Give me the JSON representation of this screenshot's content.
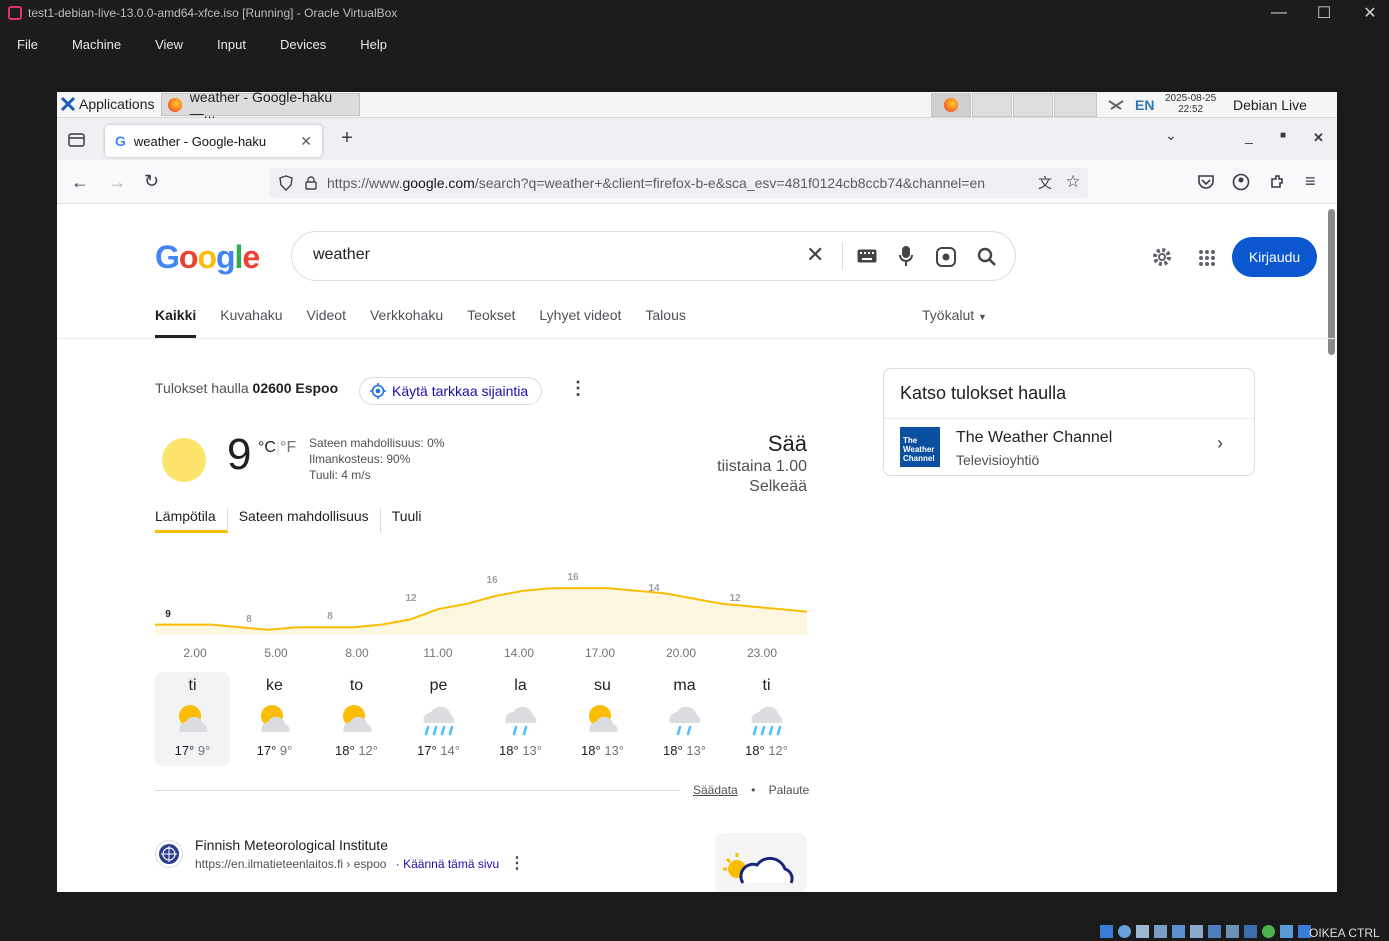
{
  "vbox": {
    "title": "test1-debian-live-13.0.0-amd64-xfce.iso [Running] - Oracle VirtualBox",
    "menu": [
      "File",
      "Machine",
      "View",
      "Input",
      "Devices",
      "Help"
    ],
    "host_key": "OIKEA CTRL"
  },
  "xfce": {
    "applications": "Applications",
    "task_title": "weather - Google-haku —...",
    "lang": "EN",
    "date": "2025-08-25",
    "time": "22:52",
    "user": "Debian Live user"
  },
  "browser": {
    "tab_title": "weather - Google-haku",
    "url_prefix": "https://www.",
    "url_domain": "google.com",
    "url_rest": "/search?q=weather+&client=firefox-b-e&sca_esv=481f0124cb8ccb74&channel=en"
  },
  "google": {
    "query": "weather",
    "signin": "Kirjaudu",
    "tabs": [
      "Kaikki",
      "Kuvahaku",
      "Videot",
      "Verkkohaku",
      "Teokset",
      "Lyhyet videot",
      "Talous"
    ],
    "tools": "Työkalut"
  },
  "weather": {
    "results_prefix": "Tulokset haulla",
    "location": "02600 Espoo",
    "precise_location": "Käytä tarkkaa sijaintia",
    "temp": "9",
    "unit_c": "°C",
    "unit_sep": "|",
    "unit_f": "°F",
    "precip": "Sateen mahdollisuus: 0%",
    "humidity": "Ilmankosteus: 90%",
    "wind": "Tuuli: 4 m/s",
    "heading": "Sää",
    "day": "tiistaina 1.00",
    "condition": "Selkeää",
    "tabs": [
      "Lämpötila",
      "Sateen mahdollisuus",
      "Tuuli"
    ],
    "hours": [
      "2.00",
      "5.00",
      "8.00",
      "11.00",
      "14.00",
      "17.00",
      "20.00",
      "23.00"
    ],
    "chart_labels": [
      "9",
      "8",
      "8",
      "12",
      "16",
      "16",
      "14",
      "12"
    ],
    "days": [
      {
        "name": "ti",
        "hi": "17°",
        "lo": "9°",
        "icon": "partly-cloudy"
      },
      {
        "name": "ke",
        "hi": "17°",
        "lo": "9°",
        "icon": "partly-cloudy"
      },
      {
        "name": "to",
        "hi": "18°",
        "lo": "12°",
        "icon": "partly-cloudy"
      },
      {
        "name": "pe",
        "hi": "17°",
        "lo": "14°",
        "icon": "rain"
      },
      {
        "name": "la",
        "hi": "18°",
        "lo": "13°",
        "icon": "light-rain"
      },
      {
        "name": "su",
        "hi": "18°",
        "lo": "13°",
        "icon": "partly-cloudy"
      },
      {
        "name": "ma",
        "hi": "18°",
        "lo": "13°",
        "icon": "light-rain"
      },
      {
        "name": "ti",
        "hi": "18°",
        "lo": "12°",
        "icon": "rain"
      }
    ],
    "data_source": "Säädata",
    "bullet": "•",
    "feedback": "Palaute"
  },
  "knowledge": {
    "title": "Katso tulokset haulla",
    "item_name": "The Weather Channel",
    "item_sub": "Televisioyhtiö",
    "logo_text": "The Weather Channel"
  },
  "result": {
    "site_name": "Finnish Meteorological Institute",
    "cite": "https://en.ilmatieteenlaitos.fi › espoo",
    "translate": "Käännä tämä sivu"
  },
  "chart_data": {
    "type": "area",
    "x": [
      "1.00",
      "2.00",
      "3.00",
      "4.00",
      "5.00",
      "6.00",
      "7.00",
      "8.00",
      "9.00",
      "10.00",
      "11.00",
      "12.00",
      "13.00",
      "14.00",
      "15.00",
      "16.00",
      "17.00",
      "18.00",
      "19.00",
      "20.00",
      "21.00",
      "22.00",
      "23.00",
      "24.00"
    ],
    "values": [
      9,
      9,
      9,
      8.5,
      8,
      8.5,
      8.5,
      8.5,
      9,
      10,
      12,
      13,
      14.5,
      15.5,
      16,
      16,
      16,
      15.5,
      15,
      14,
      13,
      12.5,
      12,
      11.5
    ],
    "ylim": [
      7,
      17
    ],
    "color": "#fbbc04"
  }
}
